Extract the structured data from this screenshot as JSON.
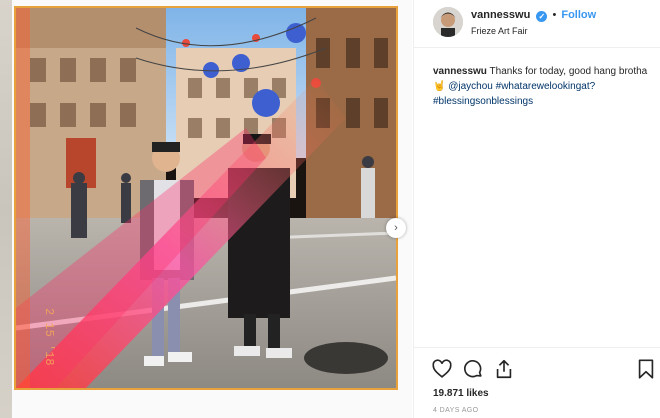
{
  "post": {
    "username": "vannesswu",
    "verified": true,
    "follow_label": "Follow",
    "separator": "•",
    "location": "Frieze Art Fair"
  },
  "caption": {
    "username": "vannesswu",
    "text": "Thanks for today, good hang brotha🤘",
    "mention": "@jaychou",
    "hashtags": [
      "#whatarewelookingat?",
      "#blessingsonblessings"
    ]
  },
  "photo": {
    "date_stamp": "2 15 '18",
    "alt": "Two men standing on a festive street"
  },
  "actions": {
    "like_icon": "heart-icon",
    "comment_icon": "comment-icon",
    "share_icon": "share-icon",
    "save_icon": "bookmark-icon",
    "next_icon": "chevron-right-icon",
    "next_glyph": "›"
  },
  "likes": "19.871 likes",
  "timestamp": "4 DAYS AGO",
  "colors": {
    "accent": "#3897f0",
    "link": "#003569",
    "frame": "#e9a23b"
  }
}
